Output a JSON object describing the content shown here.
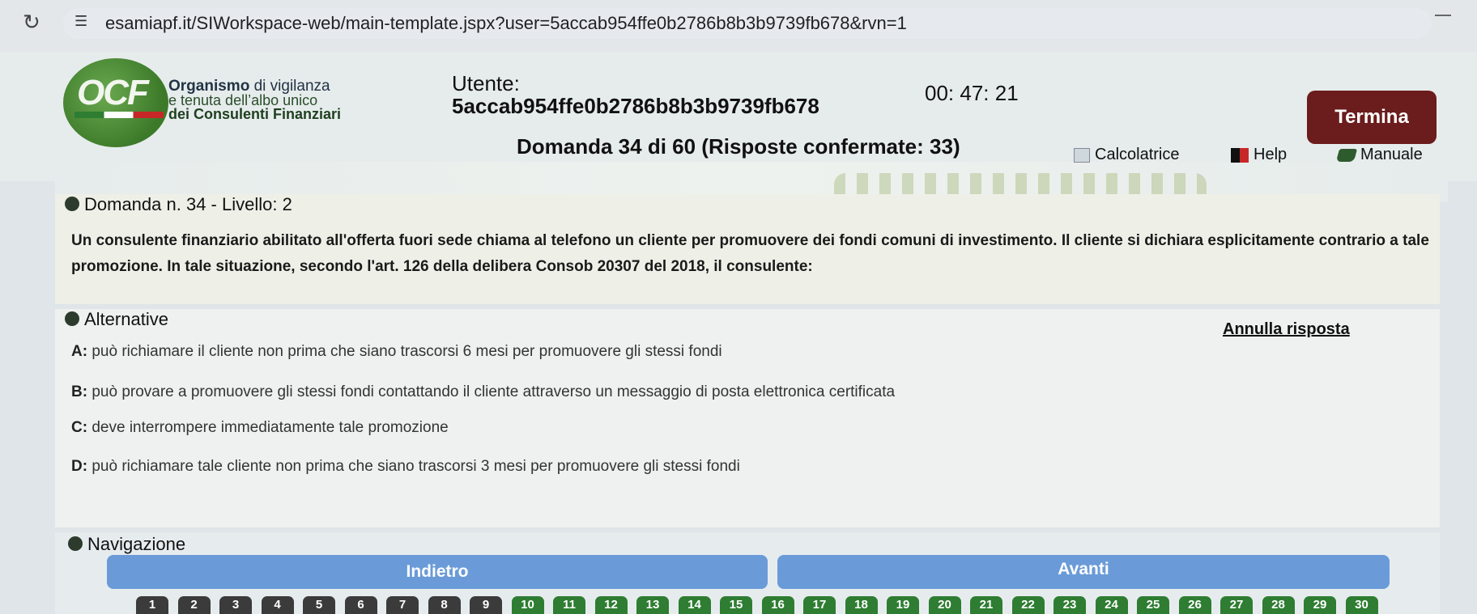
{
  "browser": {
    "url": "esamiapf.it/SIWorkspace-web/main-template.jspx?user=5accab954ffe0b2786b8b3b9739fb678&rvn=1"
  },
  "header": {
    "logo_text": "OCF",
    "org_line1_bold": "Organismo",
    "org_line1_rest": " di vigilanza",
    "org_line2": "e tenuta dell’albo unico",
    "org_line3": "dei Consulenti Finanziari",
    "user_label": "Utente:",
    "user_id": "5accab954ffe0b2786b8b3b9739fb678",
    "timer": "00: 47: 21",
    "terminate_label": "Termina",
    "question_counter": "Domanda 34 di 60 (Risposte confermate: 33)",
    "tools": {
      "calculator": "Calcolatrice",
      "help": "Help",
      "manual": "Manuale"
    }
  },
  "question": {
    "title": "Domanda n. 34 - Livello: 2",
    "text": "Un consulente finanziario abilitato all'offerta fuori sede chiama al telefono un cliente per promuovere dei fondi comuni di investimento. Il cliente si dichiara esplicitamente contrario a tale promozione. In tale situazione, secondo l'art. 126 della delibera Consob 20307 del 2018, il consulente:"
  },
  "alternatives": {
    "title": "Alternative",
    "clear_label": "Annulla risposta",
    "items": [
      {
        "letter": "A:",
        "text": " può richiamare il cliente non prima che siano trascorsi 6 mesi per promuovere gli stessi fondi"
      },
      {
        "letter": "B:",
        "text": " può provare a promuovere gli stessi fondi contattando il cliente attraverso un messaggio di posta elettronica certificata"
      },
      {
        "letter": "C:",
        "text": " deve interrompere immediatamente tale promozione"
      },
      {
        "letter": "D:",
        "text": " può richiamare tale cliente non prima che siano trascorsi 3 mesi per promuovere gli stessi fondi"
      }
    ]
  },
  "navigation": {
    "title": "Navigazione",
    "back_label": "Indietro",
    "next_label": "Avanti",
    "question_numbers": [
      "1",
      "2",
      "3",
      "4",
      "5",
      "6",
      "7",
      "8",
      "9",
      "10",
      "11",
      "12",
      "13",
      "14",
      "15",
      "16",
      "17",
      "18",
      "19",
      "20",
      "21",
      "22",
      "23",
      "24",
      "25",
      "26",
      "27",
      "28",
      "29",
      "30"
    ],
    "color_answered": "#2e7d32",
    "color_default": "#3b3b3b"
  }
}
